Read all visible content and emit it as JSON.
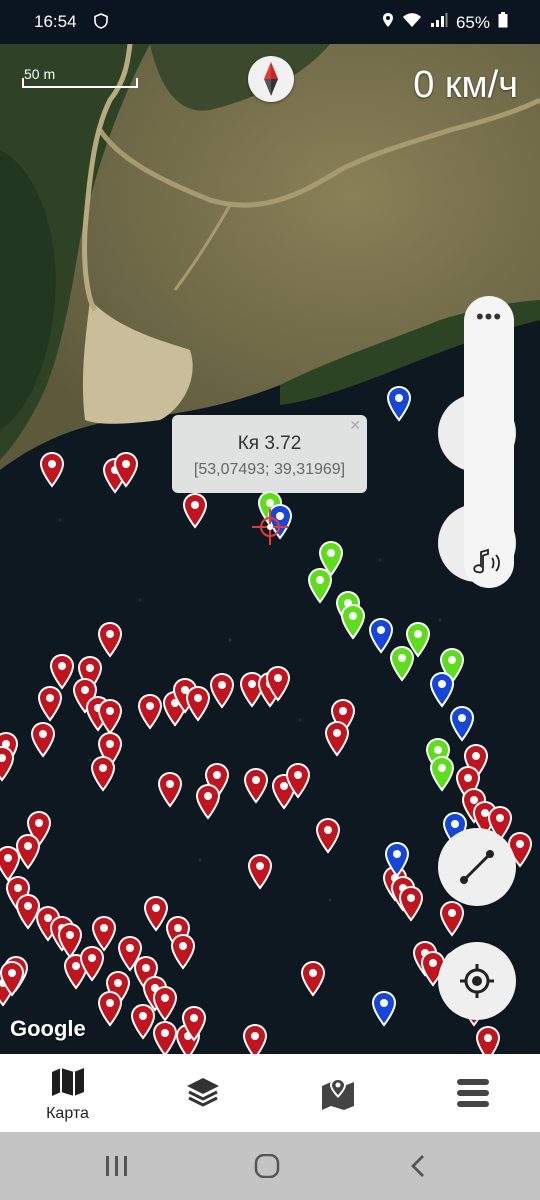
{
  "status_bar": {
    "time": "16:54",
    "battery": "65%"
  },
  "map": {
    "speed": "0 км/ч",
    "scale_label": "50 m",
    "attribution": "Google",
    "selected_marker": {
      "name": "Кя 3.72",
      "coords": "[53,07493; 39,31969]"
    },
    "marker_colors": {
      "red": "#c0141e",
      "green": "#5fdc1e",
      "blue": "#1646d8"
    }
  },
  "side_panel": {
    "menu_label": "•••"
  },
  "bottom_nav": {
    "items": [
      {
        "label": "Карта",
        "icon": "map-icon"
      },
      {
        "label": "",
        "icon": "layers-icon"
      },
      {
        "label": "",
        "icon": "map-pin-icon"
      },
      {
        "label": "",
        "icon": "menu-icon"
      }
    ]
  },
  "icons": {
    "compass": "compass-icon",
    "ruler": "ruler-icon",
    "locate": "locate-icon",
    "sound": "sound-icon",
    "close": "close-icon"
  }
}
